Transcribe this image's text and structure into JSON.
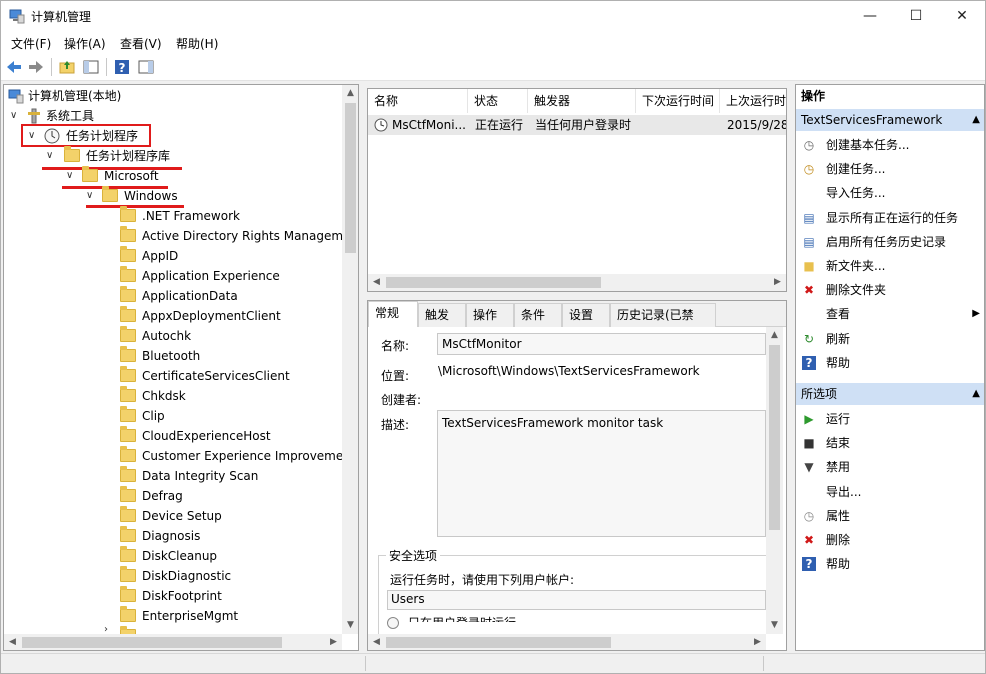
{
  "window": {
    "title": "计算机管理"
  },
  "menu": [
    "文件(F)",
    "操作(A)",
    "查看(V)",
    "帮助(H)"
  ],
  "tree": {
    "root": "计算机管理(本地)",
    "system_tools": "系统工具",
    "task_scheduler": "任务计划程序",
    "library": "任务计划程序库",
    "microsoft": "Microsoft",
    "windows": "Windows",
    "folders": [
      ".NET Framework",
      "Active Directory Rights Manageme",
      "AppID",
      "Application Experience",
      "ApplicationData",
      "AppxDeploymentClient",
      "Autochk",
      "Bluetooth",
      "CertificateServicesClient",
      "Chkdsk",
      "Clip",
      "CloudExperienceHost",
      "Customer Experience Improvemer",
      "Data Integrity Scan",
      "Defrag",
      "Device Setup",
      "Diagnosis",
      "DiskCleanup",
      "DiskDiagnostic",
      "DiskFootprint",
      "EnterpriseMgmt"
    ]
  },
  "task_list": {
    "columns": [
      "名称",
      "状态",
      "触发器",
      "下次运行时间",
      "上次运行时"
    ],
    "rows": [
      {
        "name": "MsCtfMoni...",
        "status": "正在运行",
        "trigger": "当任何用户登录时",
        "next": "",
        "last": "2015/9/28"
      }
    ]
  },
  "details": {
    "tabs": [
      "常规",
      "触发器",
      "操作",
      "条件",
      "设置",
      "历史记录(已禁用)"
    ],
    "name_label": "名称:",
    "name_value": "MsCtfMonitor",
    "location_label": "位置:",
    "location_value": "\\Microsoft\\Windows\\TextServicesFramework",
    "author_label": "创建者:",
    "desc_label": "描述:",
    "desc_value": "TextServicesFramework monitor task",
    "security_title": "安全选项",
    "run_as_label": "运行任务时，请使用下列用户帐户:",
    "run_as_value": "Users",
    "radio_text": "只在用户登录时运行"
  },
  "actions": {
    "title": "操作",
    "section1": "TextServicesFramework",
    "items1": [
      {
        "label": "创建基本任务...",
        "icon": "create-basic-task-icon"
      },
      {
        "label": "创建任务...",
        "icon": "create-task-icon"
      },
      {
        "label": "导入任务...",
        "icon": ""
      },
      {
        "label": "显示所有正在运行的任务",
        "icon": "running-tasks-icon"
      },
      {
        "label": "启用所有任务历史记录",
        "icon": "history-icon"
      },
      {
        "label": "新文件夹...",
        "icon": "new-folder-icon"
      },
      {
        "label": "删除文件夹",
        "icon": "delete-folder-icon"
      },
      {
        "label": "查看",
        "icon": ""
      },
      {
        "label": "刷新",
        "icon": "refresh-icon"
      },
      {
        "label": "帮助",
        "icon": "help-icon"
      }
    ],
    "section2": "所选项",
    "items2": [
      {
        "label": "运行",
        "icon": "run-icon"
      },
      {
        "label": "结束",
        "icon": "stop-icon"
      },
      {
        "label": "禁用",
        "icon": "disable-icon"
      },
      {
        "label": "导出...",
        "icon": ""
      },
      {
        "label": "属性",
        "icon": "properties-icon"
      },
      {
        "label": "删除",
        "icon": "delete-icon"
      },
      {
        "label": "帮助",
        "icon": "help-icon"
      }
    ]
  },
  "colors": {
    "highlight": "#e01b1b",
    "section_bg": "#cfe0f5"
  }
}
